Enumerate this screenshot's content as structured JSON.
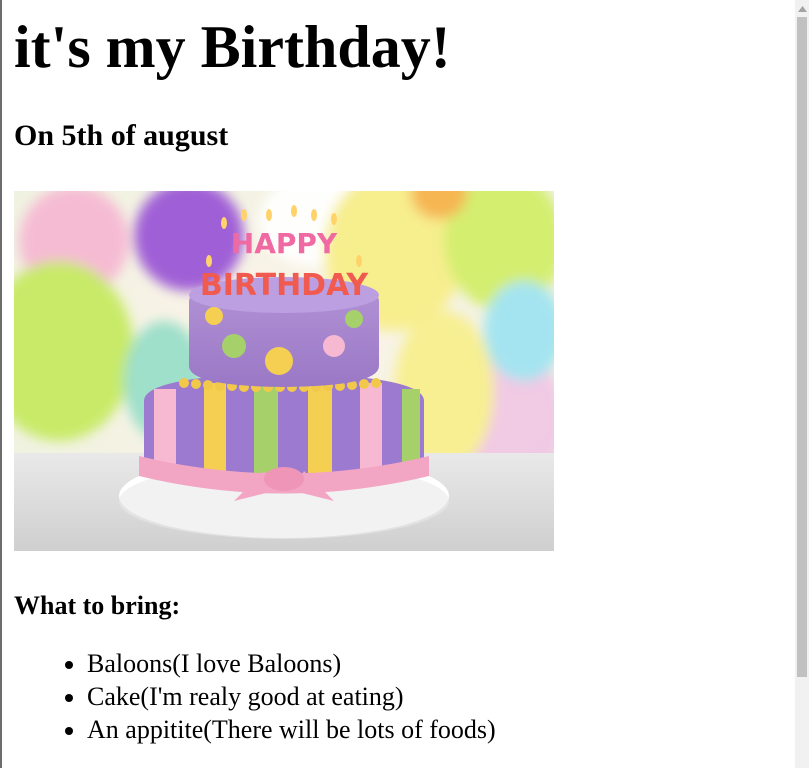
{
  "page": {
    "title": "it's my Birthday!",
    "subtitle": "On 5th of august",
    "image": {
      "banner_text_1": "HAPPY",
      "banner_text_2": "BIRTHDAY"
    },
    "bring_heading": "What to bring:",
    "bring_items": [
      "Baloons(I love Baloons)",
      "Cake(I'm realy good at eating)",
      "An appitite(There will be lots of foods)"
    ]
  },
  "scrollbar": {
    "up_icon": "chevron-up-icon"
  },
  "colors": {
    "text": "#000000",
    "background": "#ffffff",
    "scroll_track": "#f1f1f1",
    "scroll_thumb": "#c1c1c1"
  }
}
